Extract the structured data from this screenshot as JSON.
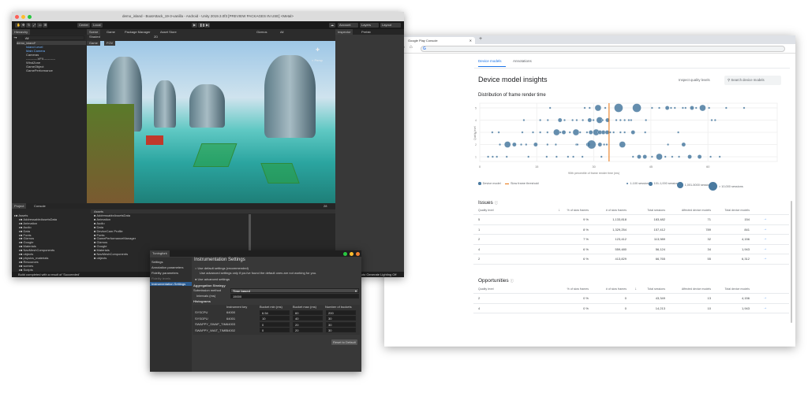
{
  "unity": {
    "title": "demo_island - BoatAttack_19-3-vanilla - Android - Unity 2019.3.0f3 [PREVIEW PACKAGES IN USE] <Metal>",
    "toolbar": {
      "center": "Center",
      "local": "Local",
      "account": "Account",
      "layers": "Layers",
      "layout": "Layout"
    },
    "hierarchy": {
      "tab": "Hierarchy",
      "search": "All",
      "scene": "demo_island*",
      "items": [
        "Island Level",
        "Main Camera",
        "Cameras",
        "-----------VFX-----------",
        "WindZone",
        "GameObject",
        "GamePerformance"
      ]
    },
    "scene_tabs": [
      "Scene",
      "Game",
      "Package Manager",
      "Asset Store"
    ],
    "scene_toolbar": {
      "shading": "Shaded",
      "twoD": "2D",
      "gizmos": "Gizmos",
      "all": "All"
    },
    "game_tab": {
      "label": "Game",
      "fov": "FOV"
    },
    "gizmo_label": "< Persp",
    "inspector_tabs": [
      "Inspector",
      "Prefab"
    ],
    "project": {
      "tabs": [
        "Project",
        "Console"
      ],
      "tree": [
        "Assets",
        "AddressableAssetsData",
        "Animation",
        "Audio",
        "Data",
        "Fonts",
        "Gizmos",
        "Google",
        "Materials",
        "NavMeshComponents",
        "objects",
        "physics_materials",
        "Resources",
        "scenes",
        "Scripts"
      ],
      "list_header": "Assets",
      "list": [
        "AddressableAssetsData",
        "Animation",
        "Audio",
        "Data",
        "DeviceCam Profile",
        "Fonts",
        "GamePerformanceManager",
        "Gizmos",
        "Google",
        "Materials",
        "NavMeshComponents",
        "objects"
      ],
      "count": "28"
    },
    "status": "Build completed with a result of 'Succeeded'",
    "status_right": "Auto Generate Lighting Off"
  },
  "tuningfork": {
    "tab": "Tuningfork",
    "nav": [
      "Settings",
      "Annotation parameters",
      "Fidelity parameters",
      "Fidelity levels",
      "Instrumentation Settings"
    ],
    "title": "Instrumentation Settings",
    "opt_default": "Use default settings (recommended)",
    "opt_note": "Use advanced settings only if you've found the default ones are not working for you.",
    "opt_advanced": "Use advanced settings",
    "aggregation": "Aggregation Strategy",
    "submission_label": "Submission method",
    "submission_value": "Time based",
    "intervals_label": "Intervals (ms)",
    "intervals_value": "15000",
    "histograms": "Histograms",
    "columns": [
      "Instrument key",
      "Bucket min (ms)",
      "Bucket max (ms)",
      "Number of buckets"
    ],
    "rows": [
      [
        "SYSCPU",
        "64000",
        "6.54",
        "60",
        "200"
      ],
      [
        "SYSGPU",
        "64001",
        "10",
        "40",
        "30"
      ],
      [
        "SWAPPY_SWAP_TIM",
        "64003",
        "0",
        "20",
        "30"
      ],
      [
        "SWAPPY_WAIT_TIME",
        "64002",
        "0",
        "20",
        "30"
      ]
    ],
    "reset": "Reset to Default"
  },
  "browser": {
    "tab_title": "Google Play Console",
    "tabs": [
      "Device models",
      "Annotations"
    ],
    "title": "Device model insights",
    "inspect": "Inspect quality levels",
    "search_placeholder": "Search device models",
    "chart_title": "Distribution of frame render time",
    "issues": {
      "title": "Issues",
      "columns": [
        "Quality level",
        "% of slow frames",
        "# of slow frames",
        "Total sessions",
        "Affected device models",
        "Total device models"
      ],
      "rows": [
        [
          "5",
          "9 %",
          "1,133,818",
          "183,482",
          "71",
          "154"
        ],
        [
          "1",
          "8 %",
          "1,329,254",
          "157,412",
          "789",
          "841"
        ],
        [
          "2",
          "7 %",
          "123,412",
          "113,989",
          "32",
          "4,156"
        ],
        [
          "4",
          "6 %",
          "559,480",
          "56,124",
          "34",
          "1,943"
        ],
        [
          "2",
          "6 %",
          "413,829",
          "66,765",
          "55",
          "6,312"
        ]
      ]
    },
    "opportunities": {
      "title": "Opportunities",
      "columns": [
        "Quality level",
        "% of slow frames",
        "# of slow frames",
        "Total sessions",
        "Affected device models",
        "Total device models"
      ],
      "rows": [
        [
          "2",
          "0 %",
          "0",
          "43,349",
          "13",
          "4,156"
        ],
        [
          "4",
          "0 %",
          "0",
          "14,213",
          "10",
          "1,943"
        ]
      ]
    },
    "accent": "#1a73e8"
  },
  "chart_data": {
    "type": "scatter",
    "title": "Distribution of frame render time",
    "xlabel": "90th percentile of frame render time (ms)",
    "ylabel": "Quality level",
    "xlim": [
      0,
      76
    ],
    "ylim": [
      1,
      5
    ],
    "xticks": [
      "0",
      "15",
      "30",
      "45",
      "60"
    ],
    "yticks": [
      "1",
      "2",
      "3",
      "4",
      "5"
    ],
    "threshold": 34,
    "legend": {
      "device": "Device model",
      "threshold": "Slow frame threshold",
      "sizes": [
        "1-100 sessions",
        "101-1,000 sessions",
        "1,001-5000 sessions",
        "> 10,000 sessions"
      ]
    },
    "color": "#4a7aa0",
    "threshold_color": "#e8710a",
    "points": [
      [
        18.5,
        5,
        1
      ],
      [
        27.6,
        5,
        1
      ],
      [
        28.9,
        5,
        1
      ],
      [
        31.1,
        5,
        3
      ],
      [
        33,
        5,
        1
      ],
      [
        36.5,
        5,
        4
      ],
      [
        41.3,
        5,
        4
      ],
      [
        45.3,
        5,
        1
      ],
      [
        47.2,
        5,
        1
      ],
      [
        49.3,
        5,
        2
      ],
      [
        50.3,
        5,
        1
      ],
      [
        51.3,
        5,
        1
      ],
      [
        53.4,
        5,
        1
      ],
      [
        54.1,
        5,
        1
      ],
      [
        55.8,
        5,
        2
      ],
      [
        56.9,
        5,
        1
      ],
      [
        58.6,
        5,
        3
      ],
      [
        60.3,
        5,
        1
      ],
      [
        64.8,
        5,
        1
      ],
      [
        69.5,
        5,
        1
      ],
      [
        11.6,
        4,
        1
      ],
      [
        15.9,
        4,
        1
      ],
      [
        17.9,
        4,
        1
      ],
      [
        21.1,
        4,
        2
      ],
      [
        22.3,
        4,
        1
      ],
      [
        24.4,
        4,
        1
      ],
      [
        25.5,
        4,
        1
      ],
      [
        27.1,
        4,
        1
      ],
      [
        28.9,
        4,
        2
      ],
      [
        29.9,
        4,
        1
      ],
      [
        31.5,
        4,
        3
      ],
      [
        32.3,
        4,
        1
      ],
      [
        33.6,
        4,
        2
      ],
      [
        35.9,
        4,
        1
      ],
      [
        37,
        4,
        1
      ],
      [
        38.1,
        4,
        1
      ],
      [
        39.2,
        4,
        1
      ],
      [
        39.8,
        4,
        1
      ],
      [
        43.7,
        4,
        1
      ],
      [
        61,
        4,
        1
      ],
      [
        61.9,
        4,
        1
      ],
      [
        3.3,
        3,
        1
      ],
      [
        5,
        3,
        1
      ],
      [
        11.2,
        3,
        1
      ],
      [
        14,
        3,
        1
      ],
      [
        15.9,
        3,
        1
      ],
      [
        17.8,
        3,
        1
      ],
      [
        20.2,
        3,
        3
      ],
      [
        21.2,
        3,
        1
      ],
      [
        22.1,
        3,
        2
      ],
      [
        23.7,
        3,
        1
      ],
      [
        25.3,
        3,
        3
      ],
      [
        26.4,
        3,
        1
      ],
      [
        28.2,
        3,
        1
      ],
      [
        29.2,
        3,
        2
      ],
      [
        30.6,
        3,
        3
      ],
      [
        31.6,
        3,
        2
      ],
      [
        32.5,
        3,
        2
      ],
      [
        33.5,
        3,
        2
      ],
      [
        34.3,
        3,
        1
      ],
      [
        35.2,
        3,
        1
      ],
      [
        37,
        3,
        1
      ],
      [
        38.1,
        3,
        1
      ],
      [
        40.3,
        3,
        2
      ],
      [
        43.5,
        3,
        1
      ],
      [
        52.2,
        3,
        1
      ],
      [
        5.3,
        2,
        1
      ],
      [
        7.3,
        2,
        3
      ],
      [
        9.1,
        2,
        2
      ],
      [
        10.9,
        2,
        1
      ],
      [
        12.2,
        2,
        1
      ],
      [
        14.7,
        2,
        2
      ],
      [
        17.8,
        2,
        1
      ],
      [
        20,
        2,
        1
      ],
      [
        25.4,
        2,
        1
      ],
      [
        25.7,
        2,
        1
      ],
      [
        28.5,
        2,
        2
      ],
      [
        29.4,
        2,
        4
      ],
      [
        31.6,
        2,
        2
      ],
      [
        32.7,
        2,
        1
      ],
      [
        33.4,
        2,
        1
      ],
      [
        37.5,
        2,
        3
      ],
      [
        49.5,
        2,
        1
      ],
      [
        53.6,
        2,
        2
      ],
      [
        2.2,
        1,
        1
      ],
      [
        3.4,
        1,
        1
      ],
      [
        4.5,
        1,
        1
      ],
      [
        7.1,
        1,
        1
      ],
      [
        12.8,
        1,
        1
      ],
      [
        17.6,
        1,
        1
      ],
      [
        20.2,
        1,
        1
      ],
      [
        23.2,
        1,
        1
      ],
      [
        24.6,
        1,
        1
      ],
      [
        27,
        1,
        1
      ],
      [
        32,
        1,
        1
      ],
      [
        40.3,
        1,
        1
      ],
      [
        41.9,
        1,
        2
      ],
      [
        43.4,
        1,
        2
      ],
      [
        45.3,
        1,
        1
      ],
      [
        47.2,
        1,
        3
      ],
      [
        48.8,
        1,
        1
      ],
      [
        50.6,
        1,
        1
      ],
      [
        52.4,
        1,
        1
      ],
      [
        55.2,
        1,
        2
      ],
      [
        57.8,
        1,
        2
      ],
      [
        60.7,
        1,
        1
      ],
      [
        63.1,
        1,
        1
      ]
    ]
  }
}
